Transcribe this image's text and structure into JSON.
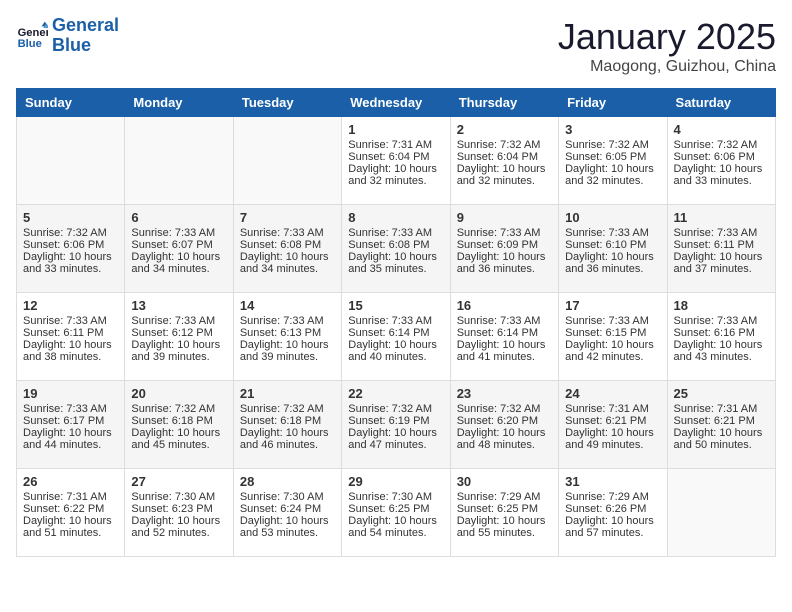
{
  "header": {
    "logo_line1": "General",
    "logo_line2": "Blue",
    "month_title": "January 2025",
    "location": "Maogong, Guizhou, China"
  },
  "weekdays": [
    "Sunday",
    "Monday",
    "Tuesday",
    "Wednesday",
    "Thursday",
    "Friday",
    "Saturday"
  ],
  "weeks": [
    [
      {
        "day": "",
        "sunrise": "",
        "sunset": "",
        "daylight": ""
      },
      {
        "day": "",
        "sunrise": "",
        "sunset": "",
        "daylight": ""
      },
      {
        "day": "",
        "sunrise": "",
        "sunset": "",
        "daylight": ""
      },
      {
        "day": "1",
        "sunrise": "Sunrise: 7:31 AM",
        "sunset": "Sunset: 6:04 PM",
        "daylight": "Daylight: 10 hours and 32 minutes."
      },
      {
        "day": "2",
        "sunrise": "Sunrise: 7:32 AM",
        "sunset": "Sunset: 6:04 PM",
        "daylight": "Daylight: 10 hours and 32 minutes."
      },
      {
        "day": "3",
        "sunrise": "Sunrise: 7:32 AM",
        "sunset": "Sunset: 6:05 PM",
        "daylight": "Daylight: 10 hours and 32 minutes."
      },
      {
        "day": "4",
        "sunrise": "Sunrise: 7:32 AM",
        "sunset": "Sunset: 6:06 PM",
        "daylight": "Daylight: 10 hours and 33 minutes."
      }
    ],
    [
      {
        "day": "5",
        "sunrise": "Sunrise: 7:32 AM",
        "sunset": "Sunset: 6:06 PM",
        "daylight": "Daylight: 10 hours and 33 minutes."
      },
      {
        "day": "6",
        "sunrise": "Sunrise: 7:33 AM",
        "sunset": "Sunset: 6:07 PM",
        "daylight": "Daylight: 10 hours and 34 minutes."
      },
      {
        "day": "7",
        "sunrise": "Sunrise: 7:33 AM",
        "sunset": "Sunset: 6:08 PM",
        "daylight": "Daylight: 10 hours and 34 minutes."
      },
      {
        "day": "8",
        "sunrise": "Sunrise: 7:33 AM",
        "sunset": "Sunset: 6:08 PM",
        "daylight": "Daylight: 10 hours and 35 minutes."
      },
      {
        "day": "9",
        "sunrise": "Sunrise: 7:33 AM",
        "sunset": "Sunset: 6:09 PM",
        "daylight": "Daylight: 10 hours and 36 minutes."
      },
      {
        "day": "10",
        "sunrise": "Sunrise: 7:33 AM",
        "sunset": "Sunset: 6:10 PM",
        "daylight": "Daylight: 10 hours and 36 minutes."
      },
      {
        "day": "11",
        "sunrise": "Sunrise: 7:33 AM",
        "sunset": "Sunset: 6:11 PM",
        "daylight": "Daylight: 10 hours and 37 minutes."
      }
    ],
    [
      {
        "day": "12",
        "sunrise": "Sunrise: 7:33 AM",
        "sunset": "Sunset: 6:11 PM",
        "daylight": "Daylight: 10 hours and 38 minutes."
      },
      {
        "day": "13",
        "sunrise": "Sunrise: 7:33 AM",
        "sunset": "Sunset: 6:12 PM",
        "daylight": "Daylight: 10 hours and 39 minutes."
      },
      {
        "day": "14",
        "sunrise": "Sunrise: 7:33 AM",
        "sunset": "Sunset: 6:13 PM",
        "daylight": "Daylight: 10 hours and 39 minutes."
      },
      {
        "day": "15",
        "sunrise": "Sunrise: 7:33 AM",
        "sunset": "Sunset: 6:14 PM",
        "daylight": "Daylight: 10 hours and 40 minutes."
      },
      {
        "day": "16",
        "sunrise": "Sunrise: 7:33 AM",
        "sunset": "Sunset: 6:14 PM",
        "daylight": "Daylight: 10 hours and 41 minutes."
      },
      {
        "day": "17",
        "sunrise": "Sunrise: 7:33 AM",
        "sunset": "Sunset: 6:15 PM",
        "daylight": "Daylight: 10 hours and 42 minutes."
      },
      {
        "day": "18",
        "sunrise": "Sunrise: 7:33 AM",
        "sunset": "Sunset: 6:16 PM",
        "daylight": "Daylight: 10 hours and 43 minutes."
      }
    ],
    [
      {
        "day": "19",
        "sunrise": "Sunrise: 7:33 AM",
        "sunset": "Sunset: 6:17 PM",
        "daylight": "Daylight: 10 hours and 44 minutes."
      },
      {
        "day": "20",
        "sunrise": "Sunrise: 7:32 AM",
        "sunset": "Sunset: 6:18 PM",
        "daylight": "Daylight: 10 hours and 45 minutes."
      },
      {
        "day": "21",
        "sunrise": "Sunrise: 7:32 AM",
        "sunset": "Sunset: 6:18 PM",
        "daylight": "Daylight: 10 hours and 46 minutes."
      },
      {
        "day": "22",
        "sunrise": "Sunrise: 7:32 AM",
        "sunset": "Sunset: 6:19 PM",
        "daylight": "Daylight: 10 hours and 47 minutes."
      },
      {
        "day": "23",
        "sunrise": "Sunrise: 7:32 AM",
        "sunset": "Sunset: 6:20 PM",
        "daylight": "Daylight: 10 hours and 48 minutes."
      },
      {
        "day": "24",
        "sunrise": "Sunrise: 7:31 AM",
        "sunset": "Sunset: 6:21 PM",
        "daylight": "Daylight: 10 hours and 49 minutes."
      },
      {
        "day": "25",
        "sunrise": "Sunrise: 7:31 AM",
        "sunset": "Sunset: 6:21 PM",
        "daylight": "Daylight: 10 hours and 50 minutes."
      }
    ],
    [
      {
        "day": "26",
        "sunrise": "Sunrise: 7:31 AM",
        "sunset": "Sunset: 6:22 PM",
        "daylight": "Daylight: 10 hours and 51 minutes."
      },
      {
        "day": "27",
        "sunrise": "Sunrise: 7:30 AM",
        "sunset": "Sunset: 6:23 PM",
        "daylight": "Daylight: 10 hours and 52 minutes."
      },
      {
        "day": "28",
        "sunrise": "Sunrise: 7:30 AM",
        "sunset": "Sunset: 6:24 PM",
        "daylight": "Daylight: 10 hours and 53 minutes."
      },
      {
        "day": "29",
        "sunrise": "Sunrise: 7:30 AM",
        "sunset": "Sunset: 6:25 PM",
        "daylight": "Daylight: 10 hours and 54 minutes."
      },
      {
        "day": "30",
        "sunrise": "Sunrise: 7:29 AM",
        "sunset": "Sunset: 6:25 PM",
        "daylight": "Daylight: 10 hours and 55 minutes."
      },
      {
        "day": "31",
        "sunrise": "Sunrise: 7:29 AM",
        "sunset": "Sunset: 6:26 PM",
        "daylight": "Daylight: 10 hours and 57 minutes."
      },
      {
        "day": "",
        "sunrise": "",
        "sunset": "",
        "daylight": ""
      }
    ]
  ]
}
